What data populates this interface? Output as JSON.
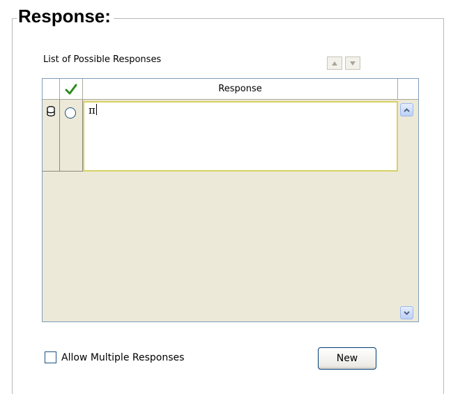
{
  "group": {
    "title": "Response:"
  },
  "list": {
    "label": "List of Possible Responses",
    "move_up_icon": "arrow-up-icon",
    "move_down_icon": "arrow-down-icon"
  },
  "grid": {
    "columns": [
      {
        "label": "",
        "icon": "none"
      },
      {
        "label": "",
        "icon": "green-checkmark-icon"
      },
      {
        "label": "Response"
      }
    ],
    "rows": [
      {
        "row_icon": "database-icon",
        "selected": false,
        "response": "π"
      }
    ]
  },
  "footer": {
    "allow_multiple_label": "Allow Multiple Responses",
    "allow_multiple_checked": false,
    "new_button_label": "New"
  },
  "colors": {
    "accent_check": "#2e8b1f",
    "edit_border": "#d8d063",
    "grid_border": "#7f9db9"
  }
}
